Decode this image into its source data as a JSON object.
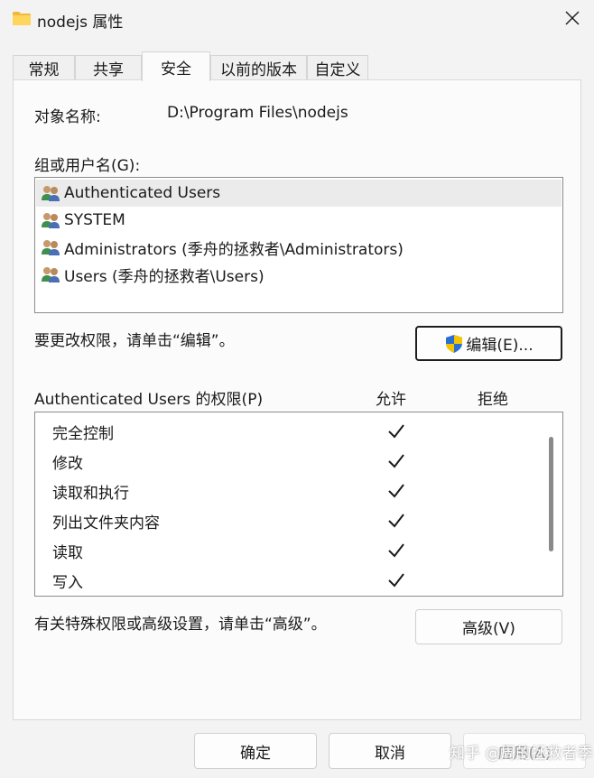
{
  "window": {
    "title": "nodejs 属性",
    "folder_icon": "folder-icon",
    "close_icon": "close-icon"
  },
  "tabs": [
    {
      "label": "常规"
    },
    {
      "label": "共享"
    },
    {
      "label": "安全",
      "active": true
    },
    {
      "label": "以前的版本"
    },
    {
      "label": "自定义"
    }
  ],
  "security": {
    "object_name_label": "对象名称:",
    "object_name_value": "D:\\Program Files\\nodejs",
    "group_label": "组或用户名(G):",
    "users": [
      {
        "name": "Authenticated Users",
        "selected": true,
        "icon": "users-icon"
      },
      {
        "name": "SYSTEM",
        "icon": "users-icon"
      },
      {
        "name": "Administrators (季舟的拯救者\\Administrators)",
        "icon": "users-icon"
      },
      {
        "name": "Users (季舟的拯救者\\Users)",
        "icon": "users-icon"
      }
    ],
    "change_hint": "要更改权限，请单击“编辑”。",
    "edit_button": "编辑(E)...",
    "edit_icon": "uac-shield-icon",
    "perm_header": "Authenticated Users 的权限(P)",
    "allow_header": "允许",
    "deny_header": "拒绝",
    "permissions": [
      {
        "name": "完全控制",
        "allow": true,
        "deny": false
      },
      {
        "name": "修改",
        "allow": true,
        "deny": false
      },
      {
        "name": "读取和执行",
        "allow": true,
        "deny": false
      },
      {
        "name": "列出文件夹内容",
        "allow": true,
        "deny": false
      },
      {
        "name": "读取",
        "allow": true,
        "deny": false
      },
      {
        "name": "写入",
        "allow": true,
        "deny": false
      }
    ],
    "advanced_hint": "有关特殊权限或高级设置，请单击“高级”。",
    "advanced_button": "高级(V)"
  },
  "footer": {
    "ok_button": "确定",
    "cancel_button": "取消",
    "apply_button": "应用(A)"
  },
  "watermark": "知乎 @周的拯救者季",
  "colors": {
    "selection": "#ebebeb",
    "panel": "#fbfbfb",
    "window": "#f3f3f3",
    "shield_blue": "#2a6fd6",
    "shield_yellow": "#f5c400"
  }
}
